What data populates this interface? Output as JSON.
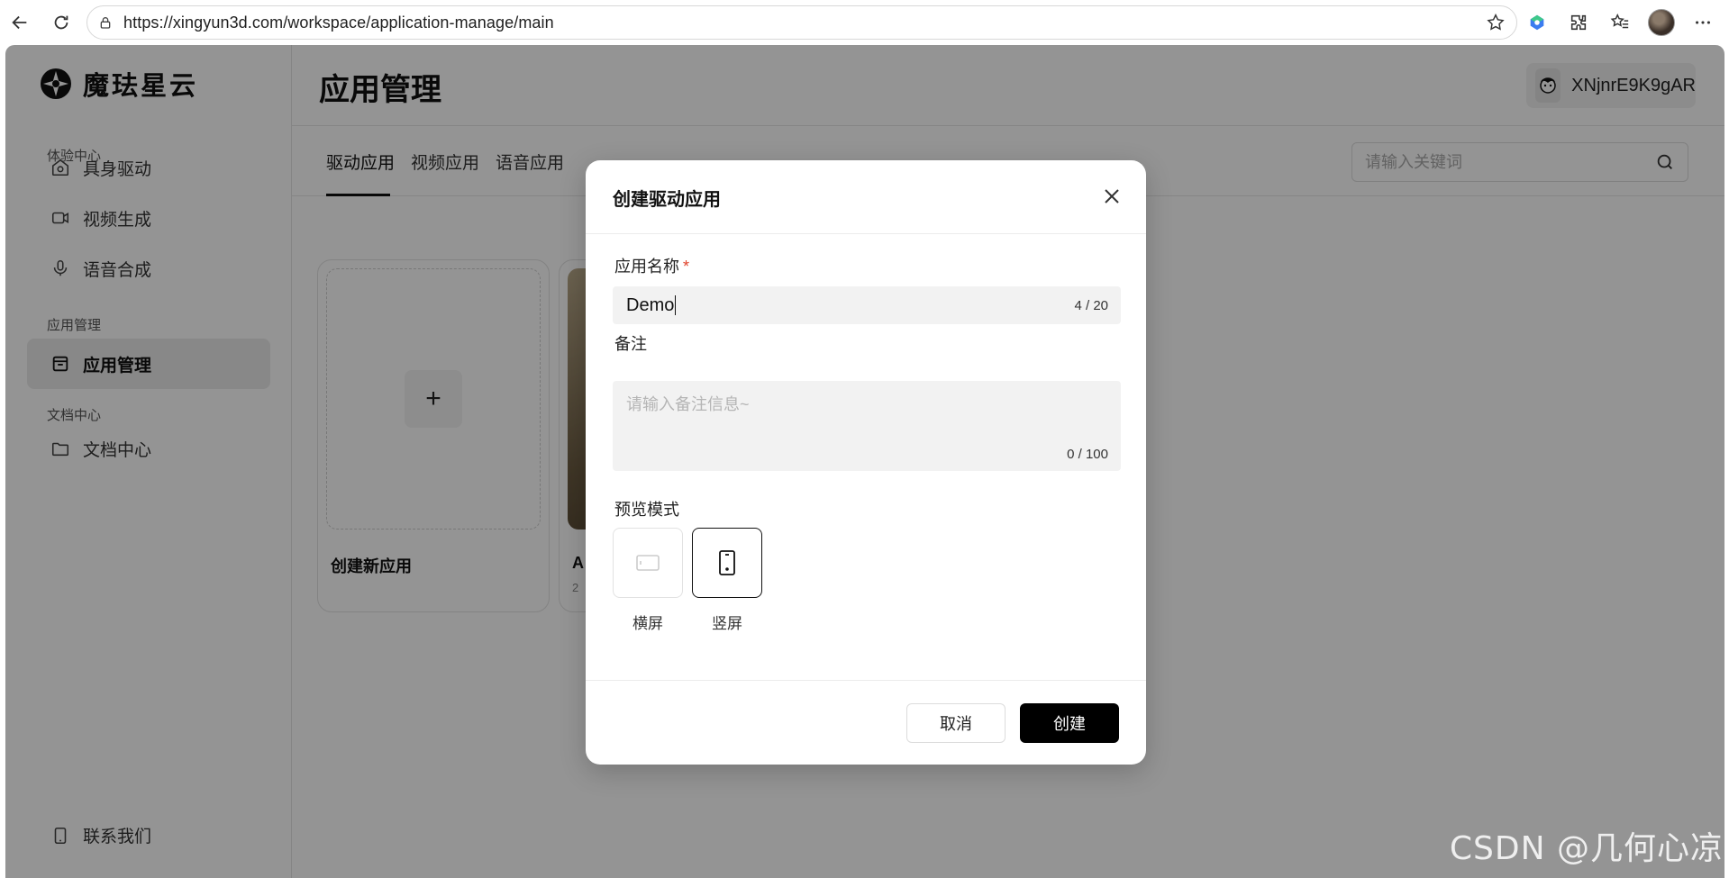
{
  "browser": {
    "url": "https://xingyun3d.com/workspace/application-manage/main"
  },
  "sidebar": {
    "logo_text": "魔珐星云",
    "groups": [
      {
        "label": "体验中心"
      },
      {
        "label": "应用管理"
      },
      {
        "label": "文档中心"
      }
    ],
    "items": [
      {
        "label": "具身驱动",
        "icon": "home-camera-icon"
      },
      {
        "label": "视频生成",
        "icon": "video-camera-icon"
      },
      {
        "label": "语音合成",
        "icon": "microphone-icon"
      },
      {
        "label": "应用管理",
        "icon": "app-box-icon",
        "active": true
      },
      {
        "label": "文档中心",
        "icon": "folder-icon"
      }
    ],
    "contact_label": "联系我们"
  },
  "header": {
    "title": "应用管理",
    "username": "XNjnrE9K9gAR"
  },
  "tabs": [
    {
      "label": "驱动应用",
      "active": true
    },
    {
      "label": "视频应用"
    },
    {
      "label": "语音应用"
    }
  ],
  "search": {
    "placeholder": "请输入关键词"
  },
  "cards": {
    "new_label": "创建新应用",
    "app_name_initial": "A",
    "app_date_prefix": "2"
  },
  "modal": {
    "title": "创建驱动应用",
    "name_label": "应用名称",
    "required_mark": "*",
    "name_value": "Demo",
    "name_counter": "4 / 20",
    "note_label": "备注",
    "note_placeholder": "请输入备注信息~",
    "note_counter": "0 / 100",
    "mode_label": "预览模式",
    "modes": [
      {
        "label": "横屏",
        "selected": false
      },
      {
        "label": "竖屏",
        "selected": true
      }
    ],
    "cancel_label": "取消",
    "create_label": "创建"
  },
  "watermark": "CSDN @几何心凉",
  "colors": {
    "primary_button": "#000000",
    "required": "#e0442c",
    "overlay": "rgba(0,0,0,0.42)"
  }
}
